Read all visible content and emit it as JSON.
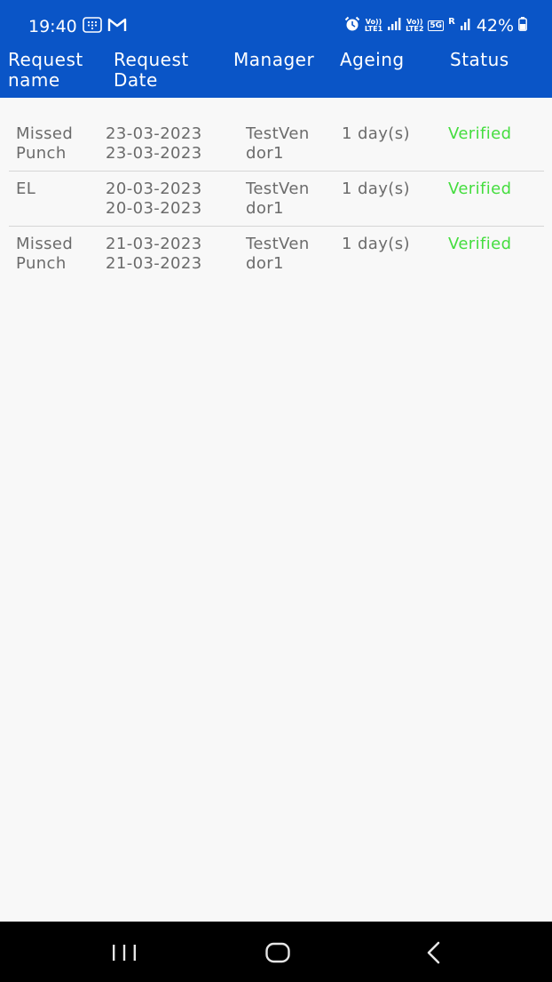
{
  "status_bar": {
    "time": "19:40",
    "battery": "42%",
    "volte1_top": "Vo))",
    "volte1_bottom": "LTE1",
    "volte2_top": "Vo))",
    "volte2_bottom": "LTE2",
    "network": "5G",
    "roaming": "R",
    "left_icons": [
      "grid-notification-icon",
      "gmail-icon"
    ],
    "right_icons": [
      "alarm-icon",
      "signal-icon",
      "signal-icon",
      "battery-icon"
    ]
  },
  "header": {
    "columns": [
      {
        "line1": "Request",
        "line2": "name"
      },
      {
        "line1": "Request",
        "line2": "Date"
      },
      {
        "line1": "Manager",
        "line2": ""
      },
      {
        "line1": "Ageing",
        "line2": ""
      },
      {
        "line1": "Status",
        "line2": ""
      }
    ]
  },
  "rows": [
    {
      "name_line1": "Missed",
      "name_line2": "Punch",
      "date_line1": "23-03-2023",
      "date_line2": "23-03-2023",
      "manager_line1": "TestVen",
      "manager_line2": "dor1",
      "ageing": "1 day(s)",
      "status": "Verified"
    },
    {
      "name_line1": "EL",
      "name_line2": "",
      "date_line1": "20-03-2023",
      "date_line2": "20-03-2023",
      "manager_line1": "TestVen",
      "manager_line2": "dor1",
      "ageing": "1 day(s)",
      "status": "Verified"
    },
    {
      "name_line1": "Missed",
      "name_line2": "Punch",
      "date_line1": "21-03-2023",
      "date_line2": "21-03-2023",
      "manager_line1": "TestVen",
      "manager_line2": "dor1",
      "ageing": "1 day(s)",
      "status": "Verified"
    }
  ],
  "colors": {
    "header_bg": "#0a55c7",
    "status_verified": "#44dd3e",
    "cell_text": "#6b6b6b",
    "page_bg": "#f8f8f8",
    "nav_bg": "#000000"
  },
  "nav_bar": {
    "icons": [
      "recents-icon",
      "home-icon",
      "back-icon"
    ]
  }
}
